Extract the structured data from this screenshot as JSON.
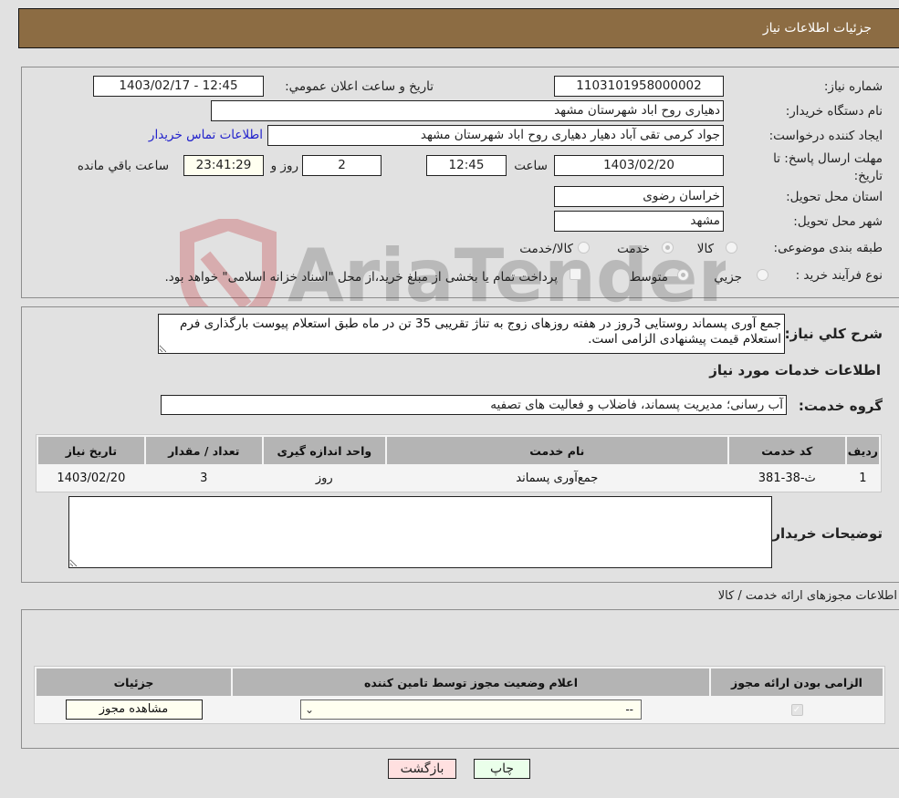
{
  "header": {
    "title": "جزئیات اطلاعات نیاز"
  },
  "details": {
    "need_number_label": "شماره نیاز:",
    "need_number": "1103101958000002",
    "announce_label": "تاریخ و ساعت اعلان عمومي:",
    "announce_value": "1403/02/17 - 12:45",
    "buyer_org_label": "نام دستگاه خریدار:",
    "buyer_org": "دهیاری روح اباد شهرستان مشهد",
    "creator_label": "ایجاد کننده درخواست:",
    "creator": "جواد کرمی تقی آباد دهیار دهیاری روح اباد شهرستان مشهد",
    "contact_link": "اطلاعات تماس خریدار",
    "deadline_label": "مهلت ارسال پاسخ: تا تاریخ:",
    "deadline_date": "1403/02/20",
    "time_label": "ساعت",
    "deadline_time": "12:45",
    "days_value": "2",
    "days_label": "روز و",
    "remaining_time": "23:41:29",
    "remaining_label": "ساعت باقي مانده",
    "province_label": "استان محل تحویل:",
    "province": "خراسان رضوی",
    "city_label": "شهر محل تحویل:",
    "city": "مشهد",
    "category_label": "طبقه بندی موضوعی:",
    "category_options": [
      {
        "label": "کالا",
        "checked": false
      },
      {
        "label": "خدمت",
        "checked": true
      },
      {
        "label": "کالا/خدمت",
        "checked": false
      }
    ],
    "process_label": "نوع فرآیند خرید :",
    "process_options": [
      {
        "label": "جزیي",
        "checked": false
      },
      {
        "label": "متوسط",
        "checked": true
      }
    ],
    "treasury_note": "پرداخت تمام یا بخشی از مبلغ خرید،از محل \"اسناد خزانه اسلامی\" خواهد بود.",
    "treasury_checked": false
  },
  "description": {
    "label": "شرح کلي نیاز:",
    "text": "جمع آوری پسماند روستایی 3روز در هفته روزهای زوج به تناژ تقریبی 35 تن در ماه طبق استعلام پیوست بارگذاری فرم استعلام قیمت پیشنهادی الزامی است."
  },
  "services": {
    "section_title": "اطلاعات خدمات مورد نیاز",
    "group_label": "گروه خدمت:",
    "group_value": "آب رسانی؛ مدیریت پسماند، فاضلاب و فعالیت های تصفیه",
    "table": {
      "headers": [
        "ردیف",
        "کد خدمت",
        "نام خدمت",
        "واحد اندازه گیری",
        "تعداد / مقدار",
        "تاریخ نیاز"
      ],
      "rows": [
        [
          "1",
          "ث-38-381",
          "جمع‌آوری پسماند",
          "روز",
          "3",
          "1403/02/20"
        ]
      ]
    },
    "buyer_notes_label": "توضیحات خریدار:",
    "buyer_notes": ""
  },
  "permits": {
    "section_title": "اطلاعات مجوزهای ارائه خدمت / کالا",
    "headers": [
      "الزامی بودن ارائه مجوز",
      "اعلام وضعیت مجوز توسط تامین کننده",
      "جزئیات"
    ],
    "row": {
      "required": true,
      "status": "--",
      "details_button": "مشاهده مجوز"
    }
  },
  "footer": {
    "print_button": "چاپ",
    "back_button": "بازگشت"
  },
  "colors": {
    "header_bg": "#8c6c43",
    "print_bg": "#eaffea",
    "back_bg": "#ffe0e0"
  }
}
